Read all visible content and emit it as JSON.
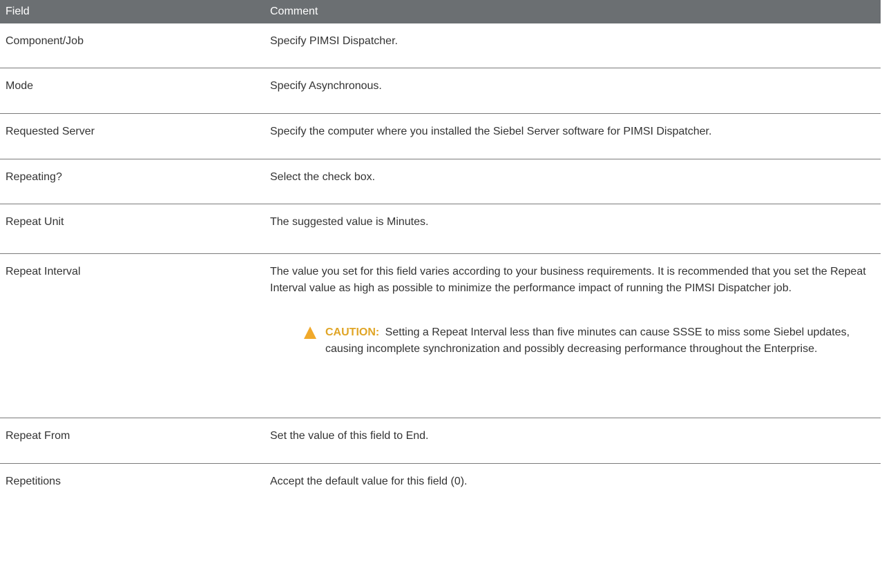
{
  "table": {
    "headers": {
      "field": "Field",
      "comment": "Comment"
    },
    "rows": [
      {
        "field": "Component/Job",
        "comment": "Specify PIMSI Dispatcher."
      },
      {
        "field": "Mode",
        "comment": "Specify Asynchronous."
      },
      {
        "field": "Requested Server",
        "comment": "Specify the computer where you installed the Siebel Server software for PIMSI Dispatcher."
      },
      {
        "field": "Repeating?",
        "comment": "Select the check box."
      },
      {
        "field": "Repeat Unit",
        "comment": "The suggested value is Minutes."
      },
      {
        "field": "Repeat Interval",
        "comment": "The value you set for this field varies according to your business requirements. It is recommended that you set the Repeat Interval value as high as possible to minimize the performance impact of running the PIMSI Dispatcher job.",
        "caution": {
          "label": "CAUTION:",
          "text": "Setting a Repeat Interval less than five minutes can cause SSSE to miss some Siebel updates, causing incomplete synchronization and possibly decreasing performance throughout the Enterprise.",
          "icon": "warning-triangle-icon",
          "color": "#e0a526"
        }
      },
      {
        "field": "Repeat From",
        "comment": "Set the value of this field to End."
      },
      {
        "field": "Repetitions",
        "comment": "Accept the default value for this field (0)."
      }
    ]
  },
  "colors": {
    "header_bg": "#6b6f72",
    "header_text": "#ffffff",
    "body_text": "#333333",
    "row_border": "#7a7a7a",
    "caution_accent": "#e0a526"
  }
}
